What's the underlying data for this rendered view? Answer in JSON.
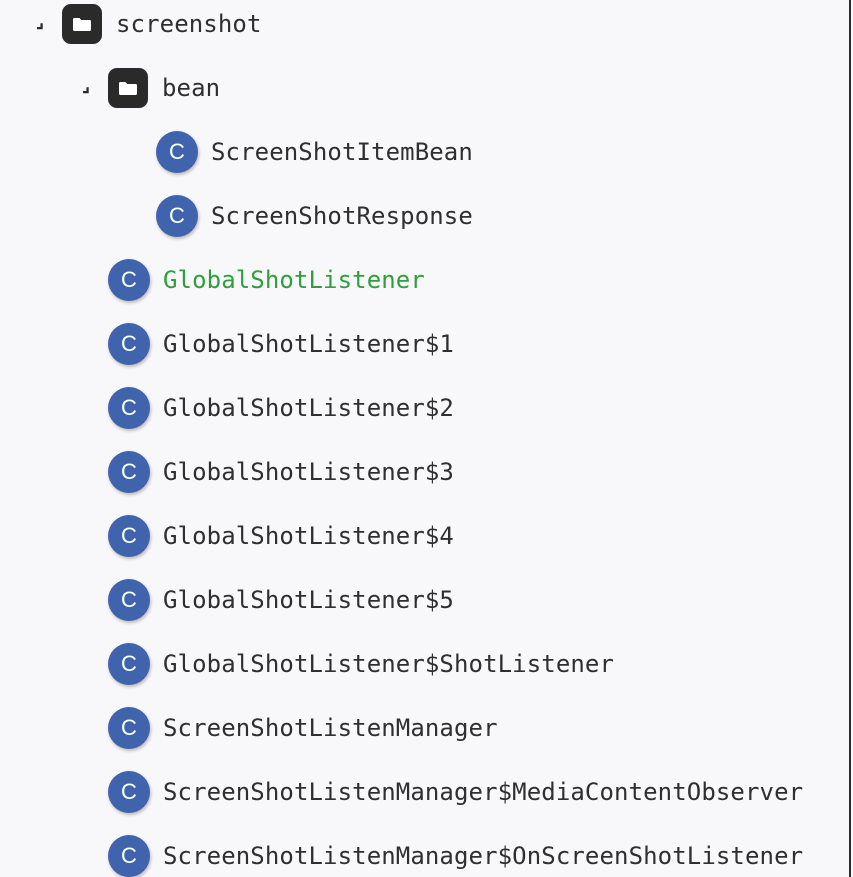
{
  "colors": {
    "background": "#f8f8fa",
    "folder_icon_bg": "#2a2a2a",
    "class_badge_bg": "#3f63ad",
    "text": "#2f2f2f",
    "selected_text": "#2e9f3a",
    "right_border": "#2b2b2b"
  },
  "tree": {
    "root": {
      "label": "screenshot",
      "icon": "folder-icon",
      "expander": "⌟"
    },
    "bean_folder": {
      "label": "bean",
      "icon": "folder-icon",
      "expander": "⌟"
    },
    "items": [
      {
        "label": "ScreenShotItemBean",
        "icon": "class-icon",
        "badge": "C"
      },
      {
        "label": "ScreenShotResponse",
        "icon": "class-icon",
        "badge": "C"
      },
      {
        "label": "GlobalShotListener",
        "icon": "class-icon",
        "badge": "C",
        "highlighted": true
      },
      {
        "label": "GlobalShotListener$1",
        "icon": "class-icon",
        "badge": "C"
      },
      {
        "label": "GlobalShotListener$2",
        "icon": "class-icon",
        "badge": "C"
      },
      {
        "label": "GlobalShotListener$3",
        "icon": "class-icon",
        "badge": "C"
      },
      {
        "label": "GlobalShotListener$4",
        "icon": "class-icon",
        "badge": "C"
      },
      {
        "label": "GlobalShotListener$5",
        "icon": "class-icon",
        "badge": "C"
      },
      {
        "label": "GlobalShotListener$ShotListener",
        "icon": "class-icon",
        "badge": "C"
      },
      {
        "label": "ScreenShotListenManager",
        "icon": "class-icon",
        "badge": "C"
      },
      {
        "label": "ScreenShotListenManager$MediaContentObserver",
        "icon": "class-icon",
        "badge": "C"
      },
      {
        "label": "ScreenShotListenManager$OnScreenShotListener",
        "icon": "class-icon",
        "badge": "C"
      }
    ]
  }
}
